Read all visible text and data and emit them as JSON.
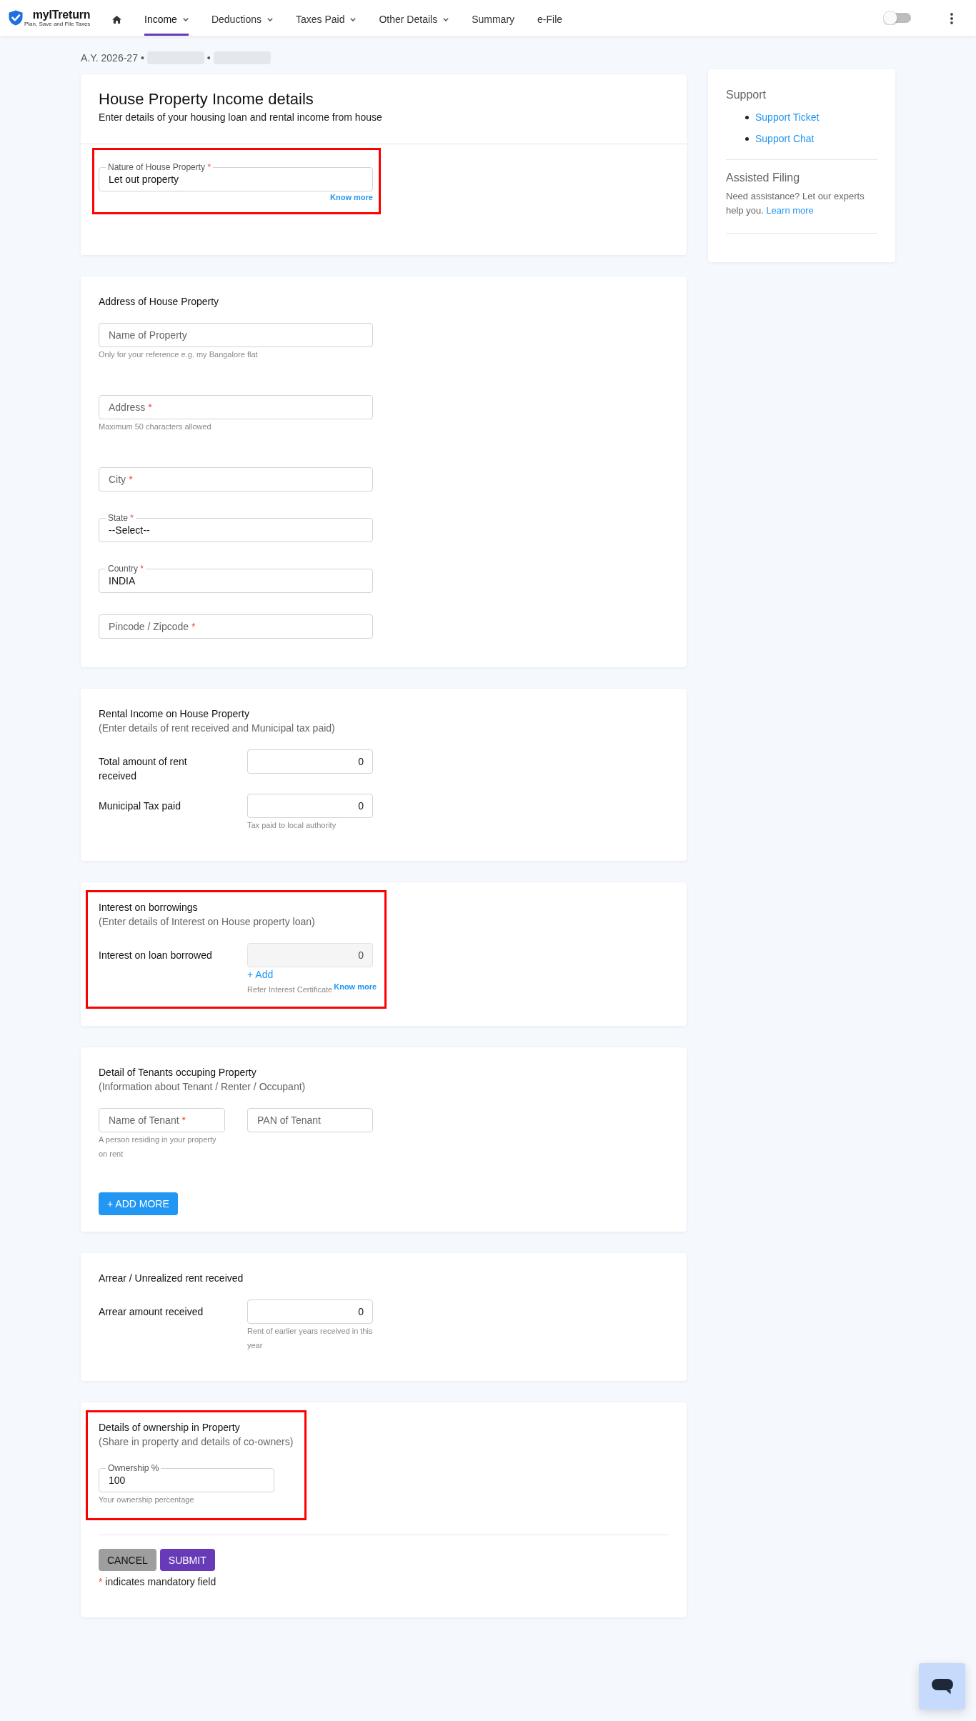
{
  "header": {
    "logo": {
      "name": "myITreturn",
      "tagline": "Plan, Save and File Taxes"
    },
    "nav": [
      {
        "kind": "home",
        "selected": false
      },
      {
        "kind": "link",
        "label": "Income",
        "has_menu": true,
        "selected": true
      },
      {
        "kind": "link",
        "label": "Deductions",
        "has_menu": true,
        "selected": false
      },
      {
        "kind": "link",
        "label": "Taxes Paid",
        "has_menu": true,
        "selected": false
      },
      {
        "kind": "link",
        "label": "Other Details",
        "has_menu": true,
        "selected": false
      },
      {
        "kind": "link",
        "label": "Summary",
        "has_menu": false,
        "selected": false
      },
      {
        "kind": "link",
        "label": "e-File",
        "has_menu": false,
        "selected": false
      }
    ],
    "toggle": {
      "on": false
    }
  },
  "breadcrumb": [
    {
      "kind": "text",
      "text": "A.Y. 2026-27"
    },
    {
      "kind": "separator",
      "text": "•"
    },
    {
      "kind": "redacted"
    },
    {
      "kind": "separator",
      "text": "•"
    },
    {
      "kind": "redacted"
    }
  ],
  "sections": [
    {
      "kind": "intro",
      "title": "House Property Income details",
      "subtitle": "Enter details of your housing loan and rental income from house",
      "highlighted": true,
      "fields": [
        {
          "kind": "select",
          "label": "Nature of House Property",
          "required_mark": "*",
          "value": "Let out property",
          "link": "Know more"
        }
      ]
    },
    {
      "kind": "standard",
      "title": "Address of House Property",
      "highlighted": false,
      "fields": [
        {
          "kind": "outlined",
          "placeholder": "Name of Property",
          "helper": "Only for your reference e.g. my Bangalore flat"
        },
        {
          "kind": "outlined",
          "placeholder": "Address",
          "required_mark": "*",
          "helper": "Maximum 50 characters allowed"
        },
        {
          "kind": "outlined",
          "placeholder": "City",
          "required_mark": "*"
        },
        {
          "kind": "select",
          "label": "State",
          "required_mark": "*",
          "value": "--Select--"
        },
        {
          "kind": "outlined",
          "label": "Country",
          "required_mark": "*",
          "value": "INDIA"
        },
        {
          "kind": "outlined",
          "placeholder": "Pincode / Zipcode",
          "required_mark": "*"
        }
      ]
    },
    {
      "kind": "standard",
      "title": "Rental Income on House Property",
      "subtitle": "(Enter details of rent received and Municipal tax paid)",
      "highlighted": false,
      "fields": [
        {
          "kind": "amount",
          "label": "Total amount of rent received",
          "value": "0",
          "readonly": false
        },
        {
          "kind": "amount",
          "label": "Municipal Tax paid",
          "value": "0",
          "readonly": false,
          "helper": "Tax paid to local authority"
        }
      ]
    },
    {
      "kind": "standard",
      "title": "Interest on borrowings",
      "subtitle": "(Enter details of Interest on House property loan)",
      "highlighted": true,
      "fields": [
        {
          "kind": "amount",
          "label": "Interest on loan borrowed",
          "value": "0",
          "readonly": true,
          "action": "+ Add",
          "helper": "Refer Interest Certificate",
          "link": "Know more"
        }
      ]
    },
    {
      "kind": "standard",
      "title": "Detail of Tenants occuping Property",
      "subtitle": "(Information about Tenant / Renter / Occupant)",
      "highlighted": false,
      "fields": [
        {
          "kind": "row",
          "fields": [
            {
              "kind": "outlined",
              "placeholder": "Name of Tenant",
              "required_mark": "*",
              "helper": "A person residing in your property on rent"
            },
            {
              "kind": "outlined",
              "placeholder": "PAN of Tenant"
            }
          ]
        }
      ],
      "button": "+ ADD MORE"
    },
    {
      "kind": "standard",
      "title": "Arrear / Unrealized rent received",
      "highlighted": false,
      "fields": [
        {
          "kind": "amount",
          "label": "Arrear amount received",
          "value": "0",
          "readonly": false,
          "helper": "Rent of earlier years received in this year"
        }
      ]
    },
    {
      "kind": "standard",
      "title": "Details of ownership in Property",
      "subtitle": "(Share in property and details of co-owners)",
      "highlighted": true,
      "fields": [
        {
          "kind": "percent",
          "label": "Ownership %",
          "value": "100",
          "helper": "Your ownership percentage"
        }
      ],
      "actions": [
        {
          "kind": "cancel",
          "label": "CANCEL"
        },
        {
          "kind": "submit",
          "label": "SUBMIT"
        }
      ],
      "note": {
        "mark": "*",
        "text": "indicates mandatory field"
      }
    }
  ],
  "sidebar": [
    {
      "kind": "links",
      "title": "Support",
      "links": [
        "Support Ticket",
        "Support Chat"
      ]
    },
    {
      "kind": "text",
      "title": "Assisted Filing",
      "text": "Need assistance? Let our experts help you.",
      "link": "Learn more"
    }
  ]
}
